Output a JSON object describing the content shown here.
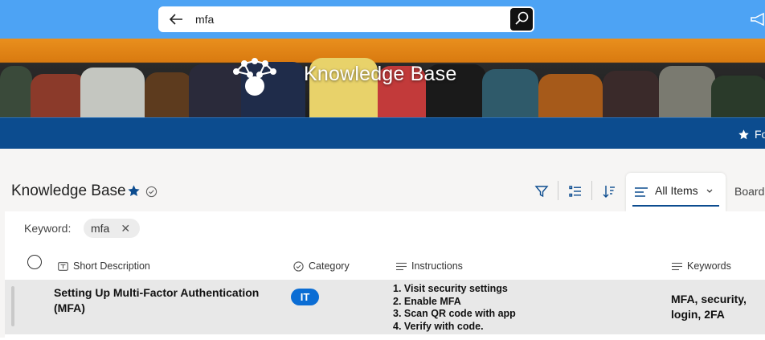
{
  "search": {
    "value": "mfa",
    "placeholder": ""
  },
  "banner": {
    "title": "Knowledge Base"
  },
  "navbar": {
    "favorites_label": "Fo"
  },
  "list": {
    "title": "Knowledge Base"
  },
  "toolbar": {
    "view_label": "All Items",
    "board_label": "Board"
  },
  "filter": {
    "label": "Keyword:",
    "value": "mfa"
  },
  "columns": {
    "short_description": "Short Description",
    "category": "Category",
    "instructions": "Instructions",
    "keywords": "Keywords"
  },
  "rows": [
    {
      "short_description": "Setting Up Multi-Factor Authentication (MFA)",
      "category": "IT",
      "instructions": [
        "1. Visit security settings",
        "2. Enable MFA",
        "3. Scan QR code with app",
        "4. Verify with code."
      ],
      "keywords": "MFA, security, login, 2FA"
    }
  ],
  "colors": {
    "topbar": "#4da3f4",
    "navbar": "#0c4c8f",
    "badge": "#0b6dd4"
  }
}
